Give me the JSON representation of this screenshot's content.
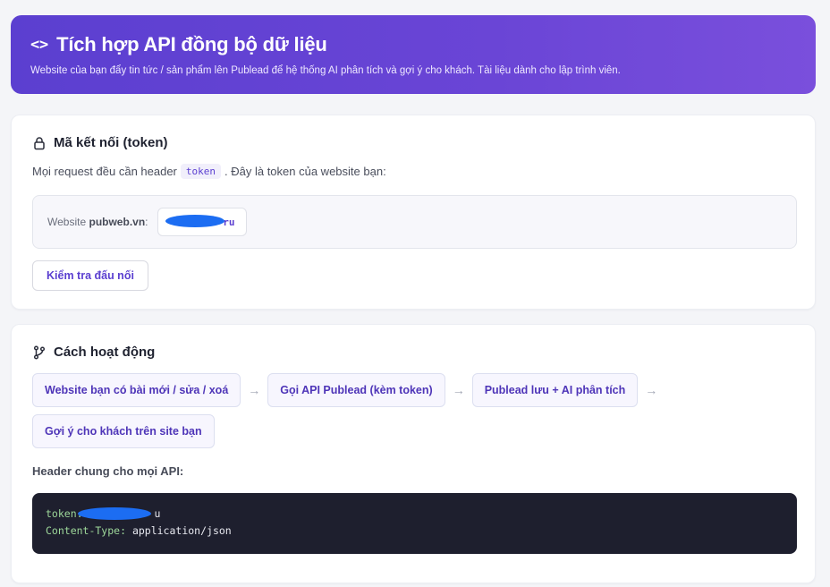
{
  "header": {
    "icon": "code-icon",
    "title": "Tích hợp API đồng bộ dữ liệu",
    "description": "Website của bạn đẩy tin tức / sản phẩm lên Publead để hệ thống AI phân tích và gợi ý cho khách. Tài liệu dành cho lập trình viên."
  },
  "token_card": {
    "icon": "lock-icon",
    "title": "Mã kết nối (token)",
    "intro_before": "Mọi request đều cần header",
    "intro_code": "token",
    "intro_after": ". Đây là token của website bạn:",
    "site_label": "Website",
    "site_name": "pubweb.vn",
    "site_colon": ":",
    "token_visible_suffix": "ru",
    "check_button": "Kiểm tra đấu nối"
  },
  "how_card": {
    "icon": "git-branch-icon",
    "title": "Cách hoạt động",
    "steps": [
      "Website bạn có bài mới / sửa / xoá",
      "Gọi API Publead (kèm token)",
      "Publead lưu + AI phân tích",
      "Gợi ý cho khách trên site bạn"
    ],
    "arrow": "→",
    "header_label": "Header chung cho mọi API:",
    "code": {
      "line1_key": "token:",
      "line1_val_suffix": "u",
      "line2_key": "Content-Type:",
      "line2_val": " application/json"
    }
  },
  "colors": {
    "accent": "#5b3fd0",
    "redaction": "#1c6df2",
    "code_bg": "#1e1f2e"
  }
}
